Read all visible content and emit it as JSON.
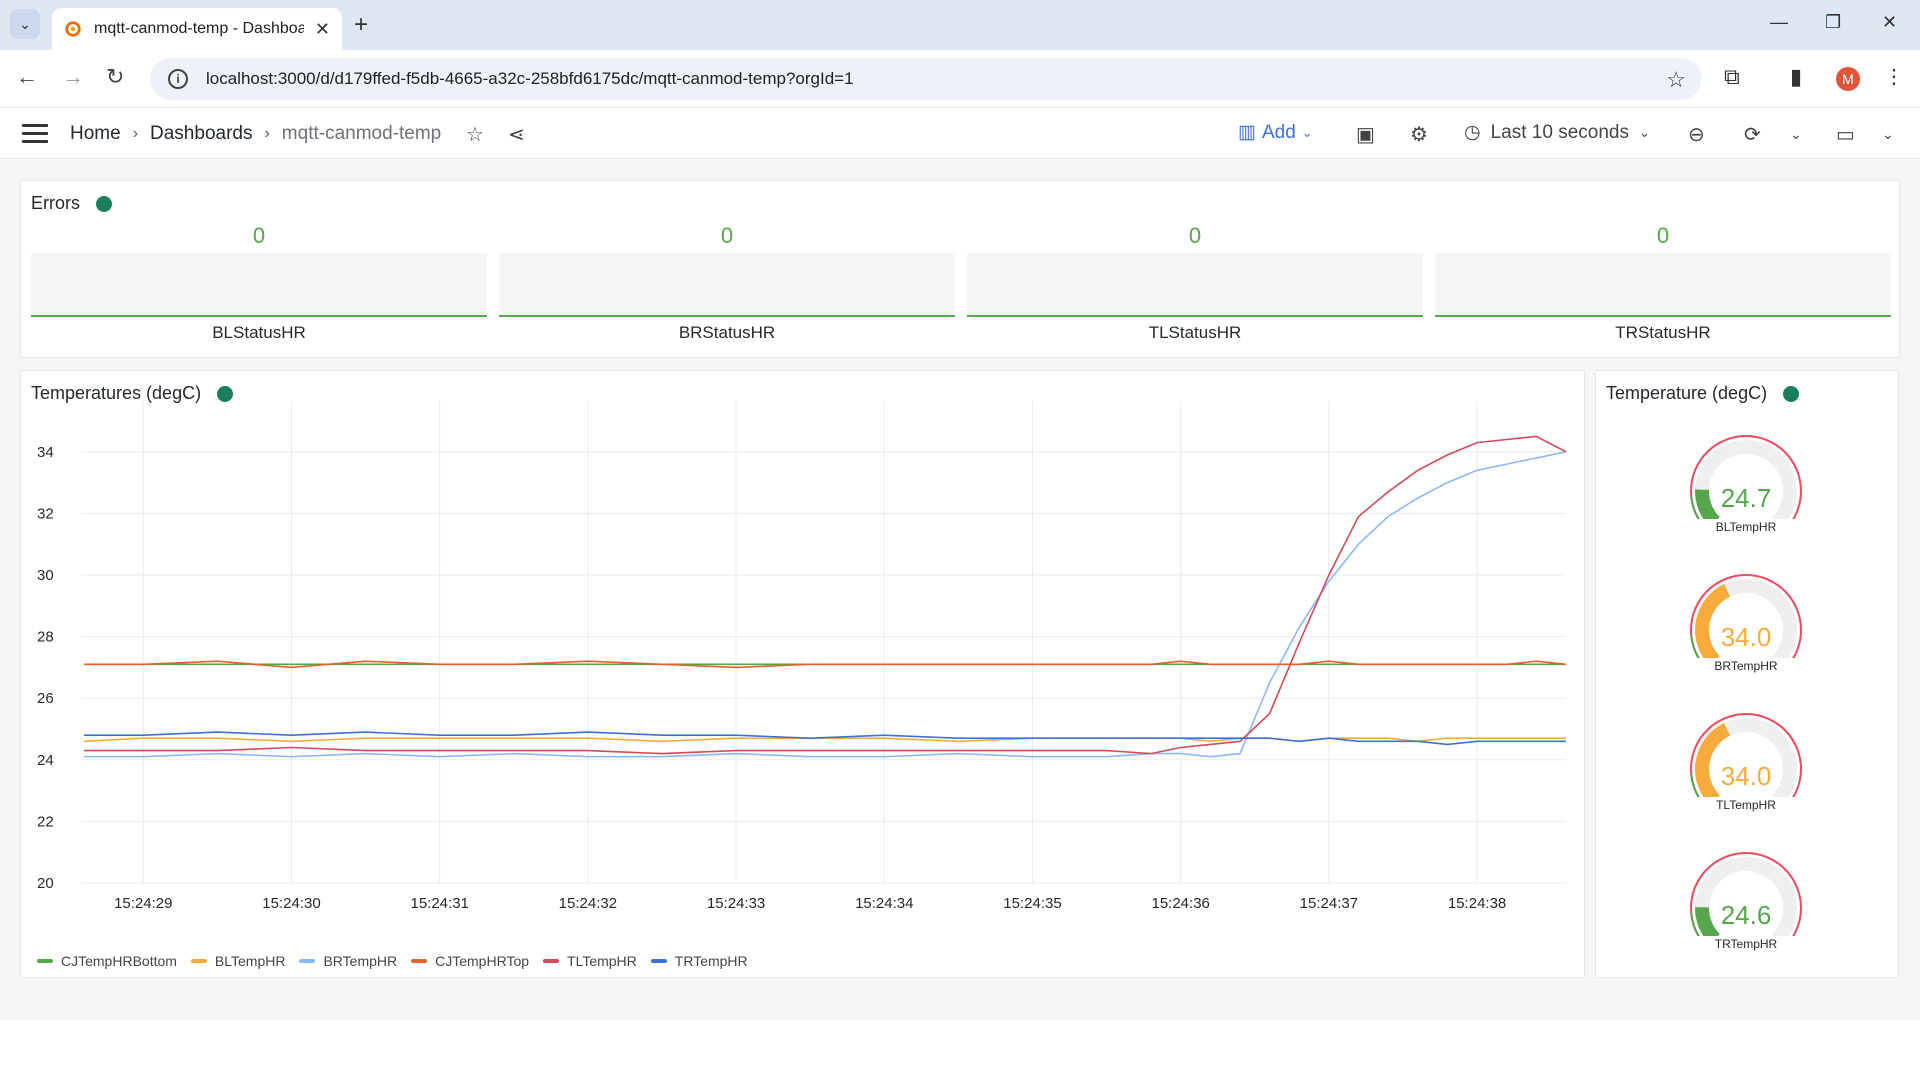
{
  "browser": {
    "tab_title": "mqtt-canmod-temp - Dashboar",
    "url": "localhost:3000/d/d179ffed-f5db-4665-a32c-258bfd6175dc/mqtt-canmod-temp?orgId=1",
    "profile_initial": "M"
  },
  "nav": {
    "breadcrumbs": [
      "Home",
      "Dashboards",
      "mqtt-canmod-temp"
    ],
    "add_label": "Add",
    "time_range": "Last 10 seconds"
  },
  "errors_panel": {
    "title": "Errors",
    "stats": [
      {
        "name": "BLStatusHR",
        "value": "0"
      },
      {
        "name": "BRStatusHR",
        "value": "0"
      },
      {
        "name": "TLStatusHR",
        "value": "0"
      },
      {
        "name": "TRStatusHR",
        "value": "0"
      }
    ]
  },
  "temps_panel": {
    "title": "Temperatures (degC)"
  },
  "gauge_panel": {
    "title": "Temperature (degC)",
    "gauges": [
      {
        "name": "BLTempHR",
        "value": "24.7",
        "num": 24.7,
        "color": "#56a64b"
      },
      {
        "name": "BRTempHR",
        "value": "34.0",
        "num": 34.0,
        "color": "#f8ab3d"
      },
      {
        "name": "TLTempHR",
        "value": "34.0",
        "num": 34.0,
        "color": "#f8ab3d"
      },
      {
        "name": "TRTempHR",
        "value": "24.6",
        "num": 24.6,
        "color": "#56a64b"
      }
    ]
  },
  "chart_data": {
    "type": "line",
    "ylim": [
      20,
      35
    ],
    "yticks": [
      20,
      22,
      24,
      26,
      28,
      30,
      32,
      34
    ],
    "x_labels": [
      "15:24:29",
      "15:24:30",
      "15:24:31",
      "15:24:32",
      "15:24:33",
      "15:24:34",
      "15:24:35",
      "15:24:36",
      "15:24:37",
      "15:24:38"
    ],
    "x": [
      28.6,
      29.0,
      29.5,
      30.0,
      30.5,
      31.0,
      31.5,
      32.0,
      32.5,
      33.0,
      33.5,
      34.0,
      34.5,
      35.0,
      35.5,
      35.8,
      36.0,
      36.2,
      36.4,
      36.6,
      36.8,
      37.0,
      37.2,
      37.4,
      37.6,
      37.8,
      38.0,
      38.2,
      38.4,
      38.6
    ],
    "series": [
      {
        "name": "CJTempHRBottom",
        "color": "#56a64b",
        "values": [
          27.1,
          27.1,
          27.1,
          27.1,
          27.1,
          27.1,
          27.1,
          27.1,
          27.1,
          27.1,
          27.1,
          27.1,
          27.1,
          27.1,
          27.1,
          27.1,
          27.1,
          27.1,
          27.1,
          27.1,
          27.1,
          27.1,
          27.1,
          27.1,
          27.1,
          27.1,
          27.1,
          27.1,
          27.1,
          27.1
        ]
      },
      {
        "name": "BLTempHR",
        "color": "#f8ab3d",
        "values": [
          24.6,
          24.7,
          24.7,
          24.6,
          24.7,
          24.7,
          24.7,
          24.7,
          24.6,
          24.7,
          24.7,
          24.7,
          24.6,
          24.7,
          24.7,
          24.7,
          24.7,
          24.6,
          24.7,
          24.7,
          24.6,
          24.7,
          24.7,
          24.7,
          24.6,
          24.7,
          24.7,
          24.7,
          24.7,
          24.7
        ]
      },
      {
        "name": "BRTempHR",
        "color": "#8ab8ff",
        "values": [
          24.1,
          24.1,
          24.2,
          24.1,
          24.2,
          24.1,
          24.2,
          24.1,
          24.1,
          24.2,
          24.1,
          24.1,
          24.2,
          24.1,
          24.1,
          24.2,
          24.2,
          24.1,
          24.2,
          26.5,
          28.3,
          29.8,
          31.0,
          31.9,
          32.5,
          33.0,
          33.4,
          33.6,
          33.8,
          34.0
        ]
      },
      {
        "name": "CJTempHRTop",
        "color": "#e6622a",
        "values": [
          27.1,
          27.1,
          27.2,
          27.0,
          27.2,
          27.1,
          27.1,
          27.2,
          27.1,
          27.0,
          27.1,
          27.1,
          27.1,
          27.1,
          27.1,
          27.1,
          27.2,
          27.1,
          27.1,
          27.1,
          27.1,
          27.2,
          27.1,
          27.1,
          27.1,
          27.1,
          27.1,
          27.1,
          27.2,
          27.1
        ]
      },
      {
        "name": "TLTempHR",
        "color": "#d44a57",
        "values": [
          24.3,
          24.3,
          24.3,
          24.4,
          24.3,
          24.3,
          24.3,
          24.3,
          24.2,
          24.3,
          24.3,
          24.3,
          24.3,
          24.3,
          24.3,
          24.2,
          24.4,
          24.5,
          24.6,
          25.5,
          27.8,
          30.0,
          31.9,
          32.7,
          33.4,
          33.9,
          34.3,
          34.4,
          34.5,
          34.0
        ]
      },
      {
        "name": "TRTempHR",
        "color": "#3d71d9",
        "values": [
          24.8,
          24.8,
          24.9,
          24.8,
          24.9,
          24.8,
          24.8,
          24.9,
          24.8,
          24.8,
          24.7,
          24.8,
          24.7,
          24.7,
          24.7,
          24.7,
          24.7,
          24.7,
          24.7,
          24.7,
          24.6,
          24.7,
          24.6,
          24.6,
          24.6,
          24.5,
          24.6,
          24.6,
          24.6,
          24.6
        ]
      }
    ]
  }
}
